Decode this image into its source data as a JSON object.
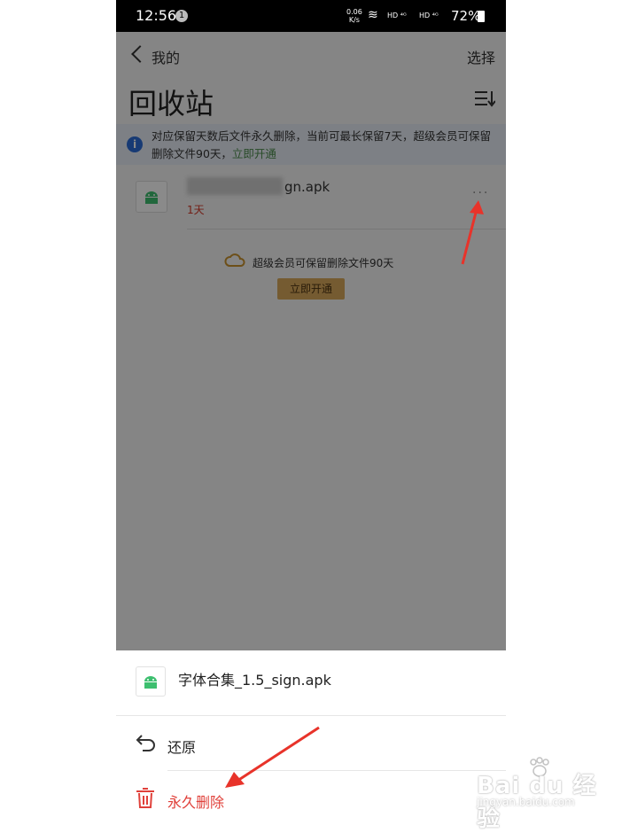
{
  "status_bar": {
    "time": "12:56",
    "notification_count": "1",
    "speed_top": "0.06",
    "speed_bottom": "K/s",
    "network1": "HD ⁴ᴳ",
    "network2": "HD ⁴ᴳ",
    "battery": "72%"
  },
  "nav": {
    "back_label": "我的",
    "select_label": "选择"
  },
  "page": {
    "title": "回收站"
  },
  "info_bar": {
    "text": "对应保留天数后文件永久删除，当前可最长保留7天，超级会员可保留删除文件90天，",
    "link": "立即开通"
  },
  "file_item": {
    "name_suffix": "gn.apk",
    "days": "1天",
    "more": "···"
  },
  "promo": {
    "text": "超级会员可保留删除文件90天",
    "button": "立即开通"
  },
  "sheet": {
    "file_name": "字体合集_1.5_sign.apk",
    "restore_label": "还原",
    "delete_label": "永久删除"
  },
  "colors": {
    "accent_green": "#4a8b4a",
    "danger_red": "#e0403a",
    "info_blue": "#2b6bd6",
    "promo_gold": "#d9a85c",
    "android_green": "#3dbf6f",
    "annotation_red": "#e8332a"
  },
  "watermark": {
    "title": "Bai du 经验",
    "url": "jingyan.baidu.com"
  }
}
